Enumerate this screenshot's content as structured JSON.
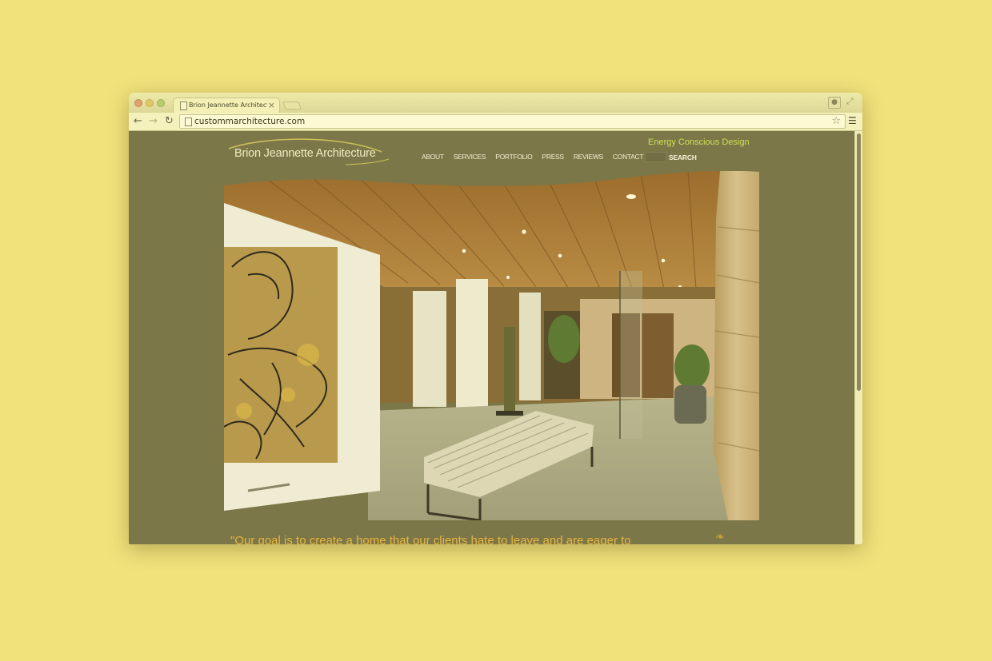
{
  "browser": {
    "tab_title": "Brion Jeannette Architectur",
    "tab_close": "×",
    "url": "custommarchitecture.com",
    "icons": [
      "back-arrow-icon",
      "forward-arrow-icon",
      "reload-icon",
      "star-icon",
      "menu-icon",
      "profile-icon",
      "fullscreen-icon"
    ]
  },
  "site": {
    "logo_text": "Brion Jeannette Architecture",
    "tagline": "Energy Conscious Design",
    "nav": [
      "ABOUT",
      "SERVICES",
      "PORTFOLIO",
      "PRESS",
      "REVIEWS",
      "CONTACT"
    ],
    "search_label": "SEARCH",
    "quote": "\"Our goal is to create a home that our clients hate to leave and are eager to"
  },
  "colors": {
    "page_background": "#f1e27c",
    "site_background": "#7c7748",
    "tagline": "#cbe056",
    "quote": "#e8b53d"
  }
}
